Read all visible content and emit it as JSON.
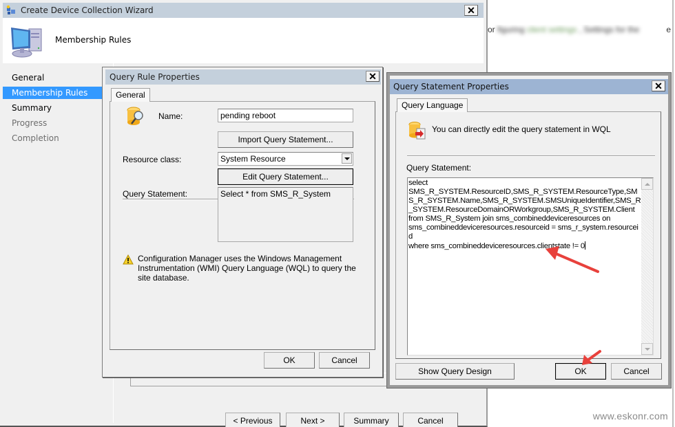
{
  "background_page": {
    "partial_text_left": "or",
    "partial_text_right": "e",
    "watermark": "www.eskonr.com"
  },
  "wizard": {
    "title": "Create Device Collection Wizard",
    "header_title": "Membership Rules",
    "nav": [
      {
        "label": "General",
        "state": "normal"
      },
      {
        "label": "Membership Rules",
        "state": "active"
      },
      {
        "label": "Summary",
        "state": "normal"
      },
      {
        "label": "Progress",
        "state": "disabled"
      },
      {
        "label": "Completion",
        "state": "disabled"
      }
    ],
    "buttons": {
      "previous": "< Previous",
      "next": "Next >",
      "summary": "Summary",
      "cancel": "Cancel"
    },
    "close_label": "✕"
  },
  "query_rule_dialog": {
    "title": "Query Rule Properties",
    "close_label": "✕",
    "tab": "General",
    "name_label": "Name:",
    "name_value": "pending reboot",
    "import_button": "Import Query Statement...",
    "resource_class_label": "Resource class:",
    "resource_class_value": "System Resource",
    "edit_button": "Edit Query Statement...",
    "query_statement_label": "Query Statement:",
    "query_statement_value": "Select * from SMS_R_System",
    "warning_text": "Configuration Manager uses the Windows Management Instrumentation (WMI) Query Language (WQL) to query the site database.",
    "ok": "OK",
    "cancel": "Cancel"
  },
  "query_statement_dialog": {
    "title": "Query Statement Properties",
    "close_label": "✕",
    "tab": "Query Language",
    "info_text": "You can directly edit the query statement in WQL",
    "query_statement_label": "Query Statement:",
    "query_text": "select\nSMS_R_SYSTEM.ResourceID,SMS_R_SYSTEM.ResourceType,SMS_R_SYSTEM.Name,SMS_R_SYSTEM.SMSUniqueIdentifier,SMS_R_SYSTEM.ResourceDomainORWorkgroup,SMS_R_SYSTEM.Client\nfrom SMS_R_System join sms_combineddeviceresources on\nsms_combineddeviceresources.resourceid = sms_r_system.resourceid\nwhere sms_combineddeviceresources.clientstate != 0",
    "show_query_design": "Show Query Design",
    "ok": "OK",
    "cancel": "Cancel"
  },
  "colors": {
    "nav_active": "#3399ff",
    "titlebar_inactive": "#c4d0dc",
    "titlebar_active": "#9db4d3",
    "annotation_arrow": "#e8413c"
  }
}
